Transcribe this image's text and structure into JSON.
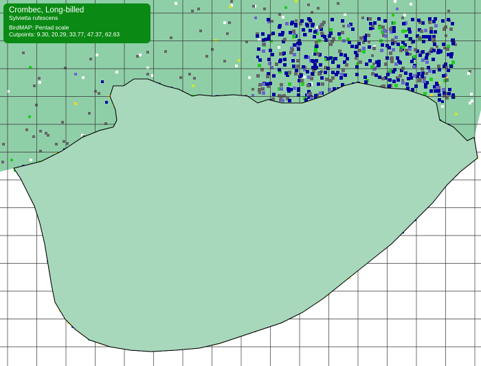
{
  "legend": {
    "title": "Crombec, Long-billed",
    "species": "Sylvietta rufescens",
    "scale": "BirdMAP: Pentad scale",
    "cutpoints": "Cutpoints: 9.30, 20.29, 33.77, 47.37, 62.63"
  },
  "colors": {
    "ocean": "#ffffff",
    "land_outside": "#8fcfa8",
    "unsurveyed": "#ffffff",
    "surveyed_absent": "#a8d8bc",
    "reporting_grey": "#666666",
    "class_1": "#ffd21e",
    "class_2": "#c8e632",
    "class_3": "#22cc22",
    "class_4": "#6666cc",
    "class_5": "#0000a0",
    "grid": "#333333",
    "border": "#000000"
  }
}
